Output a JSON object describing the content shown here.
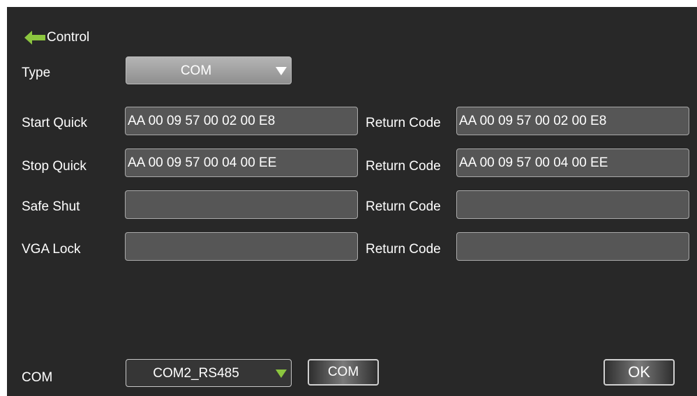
{
  "header": {
    "back_icon": "arrow-left-icon",
    "title": "Control",
    "accent": "#8cc63f"
  },
  "type_row": {
    "label": "Type",
    "selected": "COM",
    "arrow_icon": "triangle-down-icon"
  },
  "return_label": "Return Code",
  "commands": [
    {
      "label": "Start Quick",
      "code": "AA 00 09 57 00 02 00 E8",
      "return_code": "AA 00 09 57 00 02 00 E8"
    },
    {
      "label": "Stop Quick",
      "code": "AA 00 09 57 00 04 00 EE",
      "return_code": "AA 00 09 57 00 04 00 EE"
    },
    {
      "label": "Safe Shut",
      "code": "",
      "return_code": ""
    },
    {
      "label": "VGA Lock",
      "code": "",
      "return_code": ""
    }
  ],
  "footer": {
    "com_label": "COM",
    "port_selected": "COM2_RS485",
    "port_arrow_icon": "triangle-down-icon",
    "com_button": "COM",
    "ok_button": "OK"
  },
  "colors": {
    "background": "#282828",
    "field": "#565656",
    "accent_arrow": "#8cc63f"
  }
}
